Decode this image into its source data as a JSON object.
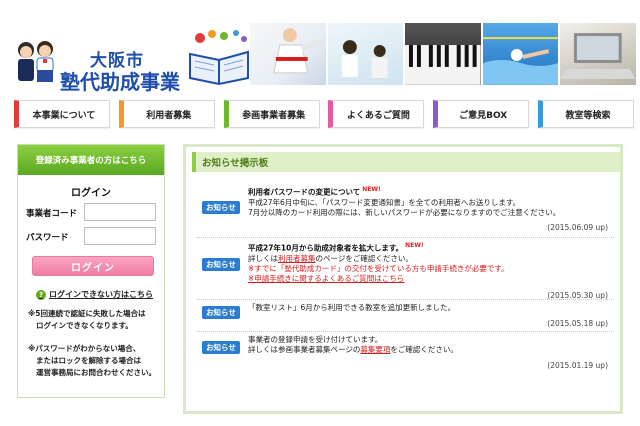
{
  "header": {
    "logo_line1": "大阪市",
    "logo_line2": "塾代助成事業"
  },
  "nav": {
    "items": [
      {
        "label": "本事業について",
        "color": "#e23b3b"
      },
      {
        "label": "利用者募集",
        "color": "#f39a1f"
      },
      {
        "label": "参画事業者募集",
        "color": "#6cb92d"
      },
      {
        "label": "よくあるご質問",
        "color": "#e85a9b"
      },
      {
        "label": "ご意見BOX",
        "color": "#8e5ac8"
      },
      {
        "label": "教室等検索",
        "color": "#3a9ad9"
      }
    ]
  },
  "login": {
    "header": "登録済み事業者の方はこちら",
    "title": "ログイン",
    "business_code_label": "事業者コード",
    "password_label": "パスワード",
    "business_code_value": "",
    "password_value": "",
    "button_label": "ログイン",
    "help_link": "ログインできない方はこちら",
    "note1_line1": "※5回連続で認証に失敗した場合は",
    "note1_line2": "ログインできなくなります。",
    "note2_line1": "※パスワードがわからない場合、",
    "note2_line2": "またはロックを解除する場合は",
    "note2_line3": "運営事務局にお問合わせください。"
  },
  "notices": {
    "title": "お知らせ掲示板",
    "badge_label": "お知らせ",
    "new_label": "NEW!",
    "items": [
      {
        "title": "利用者パスワードの変更について",
        "line1": "平成27年6月中旬に、「パスワード変更通知書」を全ての利用者へお送りします。",
        "line2": "7月分以降のカード利用の際には、新しいパスワードが必要になりますのでご注意ください。",
        "date": "(2015.06.09 up)"
      },
      {
        "title": "平成27年10月から助成対象者を拡大します。",
        "line1_pre": "詳しくは",
        "line1_link": "利用者募集",
        "line1_post": "のページをご確認ください。",
        "line2": "※すでに「塾代助成カード」の交付を受けている方も申請手続きが必要です。",
        "line3": "※申請手続きに関するよくあるご質問はこちら",
        "date": "(2015.05.30 up)"
      },
      {
        "line1": "「教室リスト」6月から利用できる教室を追加更新しました。",
        "date": "(2015.05.18 up)"
      },
      {
        "line1": "事業者の登録申請を受け付けています。",
        "line2_pre": "詳しくは参画事業者募集ページの",
        "line2_link": "募集要項",
        "line2_post": "をご確認ください。",
        "date": "(2015.01.19 up)"
      }
    ]
  }
}
